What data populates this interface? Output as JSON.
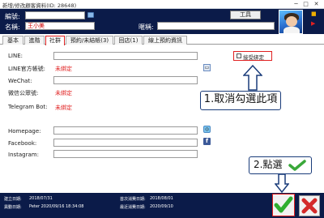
{
  "window": {
    "title": "新增/修改顧客資料(ID: 28648)",
    "minimize": "─",
    "maximize": "□",
    "close": "✕"
  },
  "header": {
    "id_label": "編號:",
    "id_value": "",
    "name_label": "名稱:",
    "name_value": "王小美",
    "alias_label": "暱稱:",
    "alias_value": "",
    "tool_button": "工具"
  },
  "tabs": [
    "基本",
    "進階",
    "社群",
    "預約/未結帳(3)",
    "回店(1)",
    "線上預約資訊"
  ],
  "active_tab_index": 2,
  "social": {
    "line_label": "LINE:",
    "line_value": "",
    "line_official_label": "LINE官方帳號:",
    "line_official_status": "未綁定",
    "wechat_label": "WeChat:",
    "wechat_value": "",
    "wechat_official_label": "微信公眾號:",
    "wechat_official_status": "未綁定",
    "telegram_label": "Telegram Bot:",
    "telegram_status": "未綁定",
    "homepage_label": "Homepage:",
    "homepage_value": "",
    "facebook_label": "Facebook:",
    "facebook_value": "",
    "instagram_label": "Instagram:",
    "instagram_value": "",
    "accept_binding_label": "接受綁定",
    "accept_binding_checked": false
  },
  "annotations": {
    "step1": "1.取消勾選此項",
    "step2": "2.點選"
  },
  "footer": {
    "created_date_label": "建立日期:",
    "created_date_value": "2018/07/31",
    "modified_date_label": "異動日期:",
    "modified_date_value": "Peter 2020/09/16 18:34:08",
    "first_visit_label": "首次消費日期:",
    "first_visit_value": "2018/08/01",
    "last_visit_label": "最近消費日期:",
    "last_visit_value": "2020/09/10"
  },
  "colors": {
    "header_bg": "#0b1b49",
    "highlight": "#e02020",
    "unset_text": "#e02020",
    "ok_green": "#2fae2f",
    "cancel_red": "#d42a2a"
  }
}
